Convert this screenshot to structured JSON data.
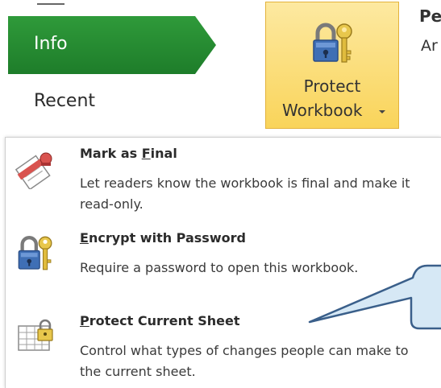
{
  "nav": {
    "items": [
      {
        "label": "Info",
        "active": true
      },
      {
        "label": "Recent",
        "active": false
      }
    ]
  },
  "protect_button": {
    "line1": "Protect",
    "line2": "Workbook"
  },
  "right_partial": {
    "title": "Pe",
    "text": "Ar"
  },
  "menu": {
    "items": [
      {
        "title_pre": "Mark as ",
        "title_key": "F",
        "title_post": "inal",
        "desc": "Let readers know the workbook is final and make it read-only.",
        "icon": "mark-final-icon"
      },
      {
        "title_pre": "",
        "title_key": "E",
        "title_post": "ncrypt with Password",
        "desc": "Require a password to open this workbook.",
        "icon": "encrypt-lock-icon"
      },
      {
        "title_pre": "",
        "title_key": "P",
        "title_post": "rotect Current Sheet",
        "desc": "Control what types of changes people can make to the current sheet.",
        "icon": "protect-sheet-icon"
      }
    ]
  },
  "colors": {
    "nav_active": "#1e7d2a",
    "button_highlight": "#f9d45a",
    "callout_fill": "#d6e8f5",
    "callout_border": "#3a5f8a"
  }
}
